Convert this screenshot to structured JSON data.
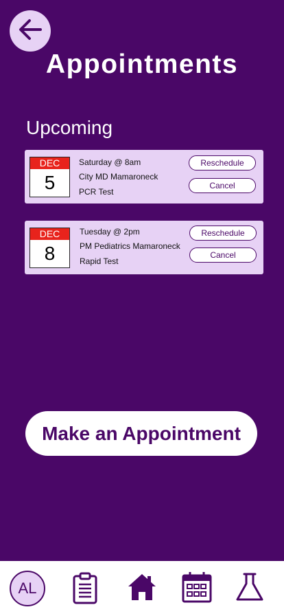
{
  "header": {
    "title": "Appointments",
    "back_icon": "arrow-left-icon"
  },
  "upcoming": {
    "title": "Upcoming",
    "appointments": [
      {
        "month": "DEC",
        "day": "5",
        "when": "Saturday @ 8am",
        "location": "City MD Mamaroneck",
        "test": "PCR Test",
        "reschedule_label": "Reschedule",
        "cancel_label": "Cancel"
      },
      {
        "month": "DEC",
        "day": "8",
        "when": "Tuesday @ 2pm",
        "location": "PM Pediatrics Mamaroneck",
        "test": "Rapid Test",
        "reschedule_label": "Reschedule",
        "cancel_label": "Cancel"
      }
    ]
  },
  "make_appointment_label": "Make an Appointment",
  "tabbar": {
    "avatar_initials": "AL",
    "icons": [
      "avatar",
      "clipboard-icon",
      "home-icon",
      "calendar-icon",
      "flask-icon"
    ]
  },
  "colors": {
    "background": "#4a0767",
    "card": "#e7d2f5",
    "calendar_header": "#e8231c",
    "text_light": "#ffffff"
  }
}
